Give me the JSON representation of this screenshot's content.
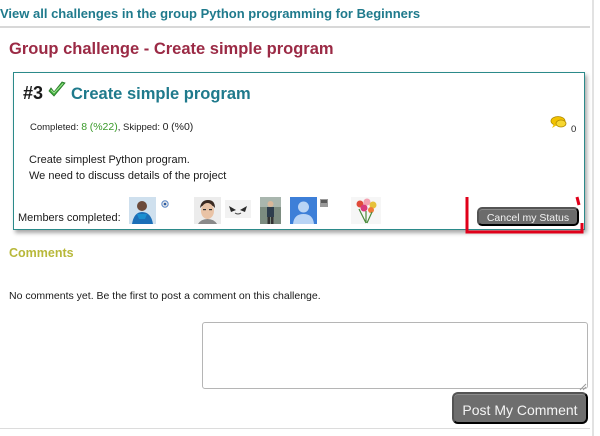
{
  "header": {
    "group_link": "View all challenges in the group Python programming for Beginners"
  },
  "page": {
    "title": "Group challenge - Create simple program"
  },
  "challenge": {
    "number": "#3",
    "title": "Create simple program",
    "stats": {
      "completed_label": "Completed: ",
      "completed_count": "8",
      "completed_pct": "(%22)",
      "separator": ", Skipped: ",
      "skipped_count": "0",
      "skipped_pct": "(%0)"
    },
    "comment_count": "0",
    "description": [
      "Create simplest Python program.",
      "We need to discuss details of the project"
    ],
    "members_label": "Members completed:",
    "cancel_button": "Cancel my Status"
  },
  "comments": {
    "heading": "Comments",
    "empty_text": "No comments yet. Be the first to post a comment on this challenge.",
    "input_value": "",
    "post_button": "Post My Comment"
  },
  "colors": {
    "link": "#1f7a8c",
    "title": "#9b2a45",
    "comments_heading": "#b8b83a",
    "completed_green": "#3a9a2a",
    "card_border": "#2b8a8a",
    "button_gray": "#6b6b6b",
    "annotation_red": "#e0001a"
  },
  "icons": {
    "check": "check-icon",
    "comment": "speech-bubble-icon",
    "avatars": [
      "avatar-person-blue",
      "avatar-status-dot",
      "avatar-man",
      "avatar-sketch",
      "avatar-standing",
      "avatar-default-blue",
      "avatar-mini",
      "avatar-flowers"
    ]
  }
}
